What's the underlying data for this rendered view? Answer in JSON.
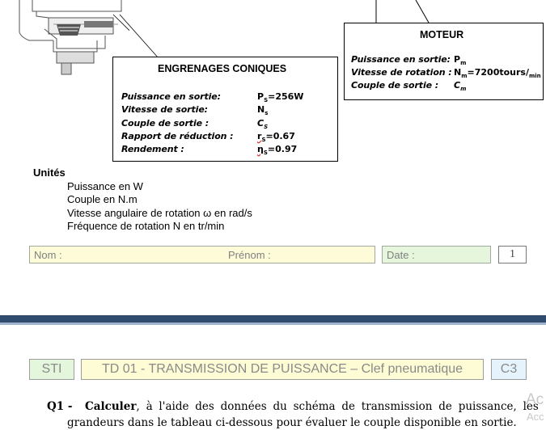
{
  "engrenages": {
    "title": "ENGRENAGES CONIQUES",
    "rows": [
      {
        "label": "Puissance en sortie:",
        "value": "P",
        "sub": "S",
        "rest": "=256W"
      },
      {
        "label": "Vitesse de sortie:",
        "value": "N",
        "sub": "s",
        "rest": ""
      },
      {
        "label": "Couple de sortie :",
        "value": "C",
        "sub": "S",
        "rest": ""
      },
      {
        "label": "Rapport de réduction :",
        "value": "r",
        "sub": "S",
        "rest": "=0.67"
      },
      {
        "label": "Rendement :",
        "value": "η",
        "sub": "S",
        "rest": "=0.97"
      }
    ]
  },
  "moteur": {
    "title": "MOTEUR",
    "rows": [
      {
        "label": "Puissance en sortie:",
        "value": "P",
        "sub": "m",
        "rest": ""
      },
      {
        "label": "Vitesse de rotation :",
        "value": "N",
        "sub": "m",
        "rest": "=7200tours/",
        "sub2": "min"
      },
      {
        "label": "Couple de sortie :",
        "value": "C",
        "sub": "m",
        "rest": ""
      }
    ]
  },
  "units": {
    "title": "Unités",
    "lines": [
      "Puissance en W",
      "Couple en N.m",
      "Vitesse angulaire de rotation ω en rad/s",
      "Fréquence de rotation N en tr/min"
    ]
  },
  "form": {
    "nom": "Nom :",
    "prenom": "Prénom :",
    "date": "Date :",
    "page": "1"
  },
  "header": {
    "sti": "STI",
    "title": "TD 01 - TRANSMISSION DE PUISSANCE – Clef pneumatique",
    "code": "C3"
  },
  "question": {
    "number": "Q1 -",
    "bold_word": "Calculer",
    "line1_rest": ", à l'aide des données du schéma de transmission de puissance, les",
    "line2": "grandeurs dans le tableau ci-dessous pour évaluer le couple disponible en sortie."
  },
  "watermark": {
    "line1": "Ac",
    "line2": "Acc"
  },
  "colors": {
    "field_bg_yellow": "#fefcd8",
    "field_bg_green": "#e6f6dc",
    "header_bg_green": "#e4f6dc",
    "header_bg_yellow": "#fefcd4",
    "header_bg_blue": "#e4f3fc",
    "separator": "#2f4b6e"
  }
}
